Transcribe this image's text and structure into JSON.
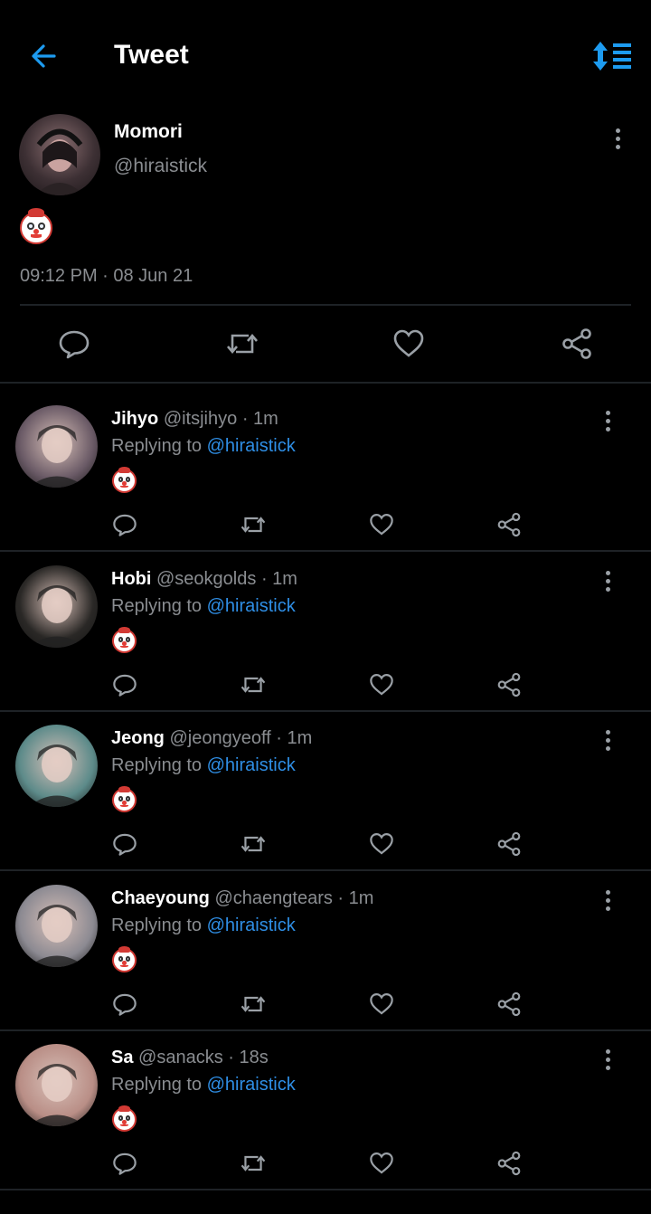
{
  "header": {
    "title": "Tweet"
  },
  "tweet": {
    "display_name": "Momori",
    "handle": "@hiraistick",
    "content": "🤡",
    "timestamp": "09:12 PM · 08 Jun 21"
  },
  "replies": [
    {
      "name": "Jihyo",
      "handle": "@itsjihyo",
      "time": "1m",
      "replying_label": "Replying to",
      "replying_to": "@hiraistick",
      "content": "🤡",
      "avatar_color": "#6a5a66"
    },
    {
      "name": "Hobi",
      "handle": "@seokgolds",
      "time": "1m",
      "replying_label": "Replying to",
      "replying_to": "@hiraistick",
      "content": "🤡",
      "avatar_color": "#2a2826"
    },
    {
      "name": "Jeong",
      "handle": "@jeongyeoff",
      "time": "1m",
      "replying_label": "Replying to",
      "replying_to": "@hiraistick",
      "content": "🤡",
      "avatar_color": "#5d8b8a"
    },
    {
      "name": "Chaeyoung",
      "handle": "@chaengtears",
      "time": "1m",
      "replying_label": "Replying to",
      "replying_to": "@hiraistick",
      "content": "🤡",
      "avatar_color": "#8c8a92"
    },
    {
      "name": "Sa",
      "handle": "@sanacks",
      "time": "18s",
      "replying_label": "Replying to",
      "replying_to": "@hiraistick",
      "content": "🤡",
      "avatar_color": "#b98e86"
    }
  ],
  "colors": {
    "accent": "#1d9bf0",
    "link": "#2f8fe6",
    "muted": "#8a8d91",
    "background": "#000000"
  },
  "icons": [
    "back-arrow-icon",
    "sort-icon",
    "more-vertical-icon",
    "reply-icon",
    "retweet-icon",
    "like-icon",
    "share-icon"
  ]
}
